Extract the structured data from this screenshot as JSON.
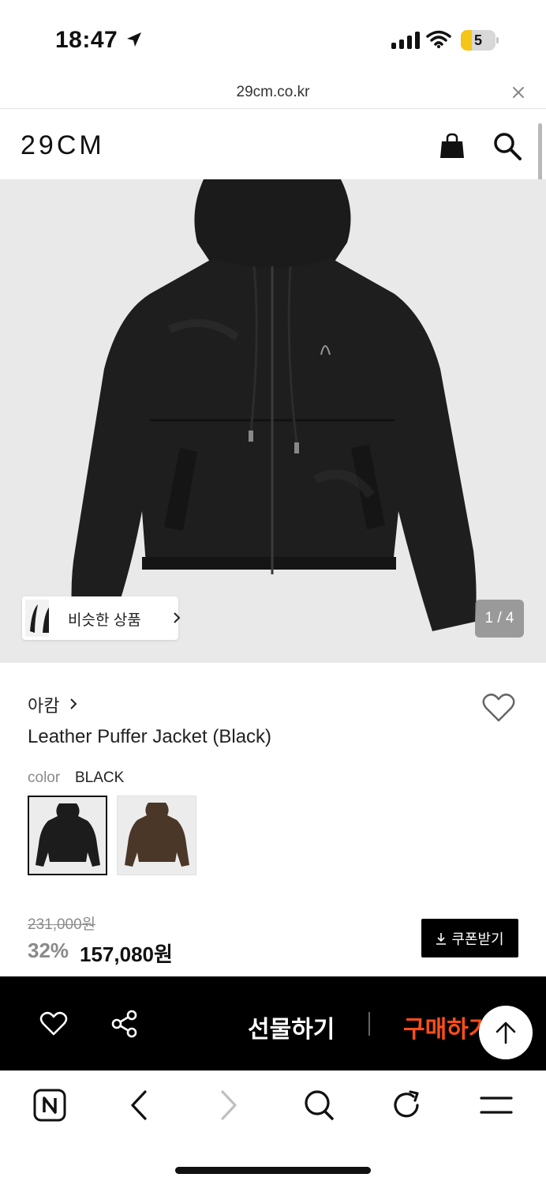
{
  "status_bar": {
    "time": "18:47",
    "battery": "5",
    "battery_color": "#f5c518"
  },
  "browser": {
    "url": "29cm.co.kr"
  },
  "site": {
    "logo": "29CM"
  },
  "gallery": {
    "similar_label": "비슷한 상품",
    "counter": "1 / 4"
  },
  "product": {
    "brand": "아캄",
    "name": "Leather Puffer Jacket (Black)",
    "color_label": "color",
    "color_value": "BLACK",
    "original_price": "231,000원",
    "discount": "32%",
    "sale_price": "157,080원",
    "coupon_label": "쿠폰받기"
  },
  "action_bar": {
    "gift_label": "선물하기",
    "buy_label": "구매하기",
    "accent": "#ff4e1a"
  },
  "icons": [
    "location-arrow-icon",
    "signal-icon",
    "wifi-icon",
    "close-icon",
    "bag-icon",
    "search-icon",
    "chevron-right-icon",
    "heart-icon",
    "share-icon",
    "arrow-up-icon",
    "naver-home-icon",
    "back-icon",
    "forward-icon",
    "refresh-icon",
    "menu-icon"
  ]
}
